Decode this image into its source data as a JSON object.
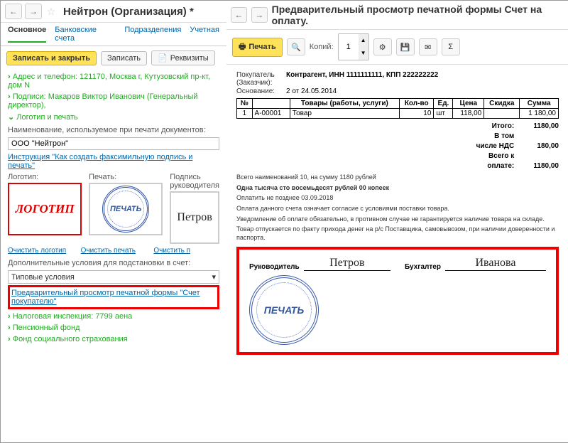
{
  "left": {
    "title": "Нейтрон (Организация) *",
    "tabs": {
      "main": "Основное",
      "bank": "Банковские счета",
      "dept": "Подразделения",
      "acct": "Учетная"
    },
    "toolbar": {
      "save_close": "Записать и закрыть",
      "save": "Записать",
      "req": "Реквизиты"
    },
    "addr": "Адрес и телефон: 121170, Москва г, Кутузовский пр-кт, дом N",
    "signs": "Подписи: Макаров Виктор Иванович (Генеральный директор),",
    "logo_section": "Логотип и печать",
    "name_label": "Наименование, используемое при печати документов:",
    "name_value": "ООО \"Нейтрон\"",
    "instr_link": "Инструкция \"Как создать факсимильную подпись и печать\"",
    "col_logo": "Логотип:",
    "col_seal": "Печать:",
    "col_sig": "Подпись руководителя",
    "logo_text": "ЛОГОТИП",
    "seal_text": "ПЕЧАТЬ",
    "sig_text": "Петров",
    "clear_logo": "Очистить логотип",
    "clear_seal": "Очистить печать",
    "clear_sig": "Очистить п",
    "extra_label": "Дополнительные условия для подстановки в счет:",
    "extra_value": "Типовые условия",
    "preview_link": "Предварительный просмотр печатной формы \"Счет покупателю\"",
    "tax": "Налоговая инспекция: 7799 аена",
    "pension": "Пенсионный фонд",
    "social": "Фонд социального страхования"
  },
  "right": {
    "title": "Предварительный просмотр печатной формы Счет на оплату.",
    "print": "Печать",
    "copies_label": "Копий:",
    "copies_value": "1",
    "buyer_label": "Покупатель (Заказчик):",
    "buyer_value": "Контрагент, ИНН 1111111111, КПП 222222222",
    "basis_label": "Основание:",
    "basis_value": "2 от 24.05.2014",
    "th": {
      "num": "№",
      "code": "",
      "goods": "Товары (работы, услуги)",
      "qty": "Кол-во",
      "unit": "Ед.",
      "price": "Цена",
      "disc": "Скидка",
      "sum": "Сумма"
    },
    "row": {
      "num": "1",
      "code": "А-00001",
      "goods": "Товар",
      "qty": "10",
      "unit": "шт",
      "price": "118,00",
      "disc": "",
      "sum": "1 180,00"
    },
    "total_lbl": "Итого:",
    "total_val": "1180,00",
    "vat_lbl": "В том числе НДС",
    "vat_val": "180,00",
    "pay_lbl": "Всего к оплате:",
    "pay_val": "1180,00",
    "summary": "Всего наименований 10, на сумму 1180 рублей",
    "words": "Одна тысяча сто восемьдесят рублей 00 копеек",
    "due": "Оплатить не позднее 03.09.2018",
    "note1": "Оплата данного счета означает согласие с условиями поставки товара.",
    "note2": "Уведомление об оплате обязательно, в противном случае не гарантируется наличие товара на складе.",
    "note3": "Товар отпускается по факту прихода денег на р/с Поставщика, самовывозом, при наличии доверенности и паспорта.",
    "mgr": "Руководитель",
    "mgr_sig": "Петров",
    "acc": "Бухгалтер",
    "acc_sig": "Иванова",
    "seal": "ПЕЧАТЬ"
  }
}
